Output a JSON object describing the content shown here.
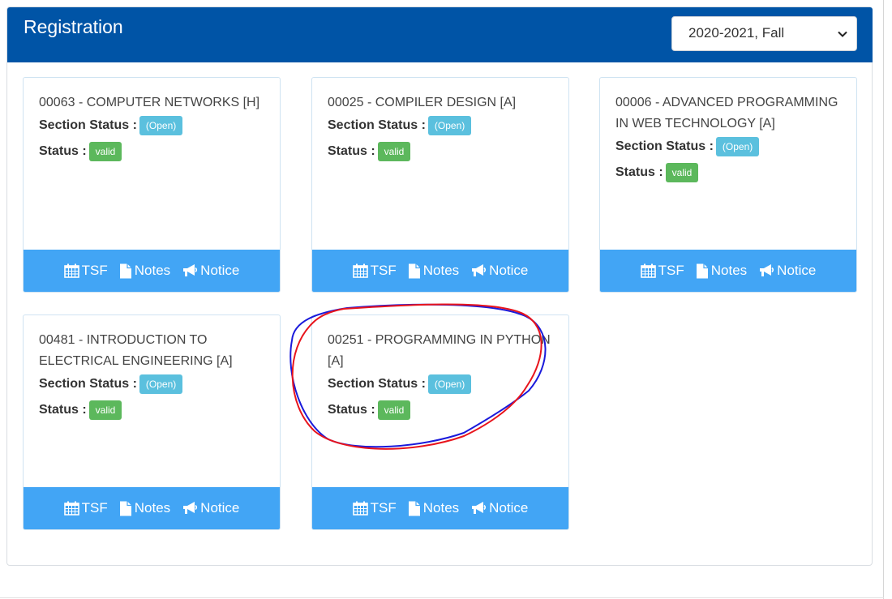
{
  "panel": {
    "title": "Registration",
    "term_select": {
      "value": "2020-2021, Fall"
    }
  },
  "labels": {
    "section_status": "Section Status :",
    "status": "Status :",
    "tsf": "TSF",
    "notes": "Notes",
    "notice": "Notice"
  },
  "courses": [
    {
      "title": "00063 - COMPUTER NETWORKS [H]",
      "section_status": "(Open)",
      "status": "valid"
    },
    {
      "title": "00025 - COMPILER DESIGN [A]",
      "section_status": "(Open)",
      "status": "valid"
    },
    {
      "title": "00006 - ADVANCED PROGRAMMING IN WEB TECHNOLOGY [A]",
      "section_status": "(Open)",
      "status": "valid"
    },
    {
      "title": "00481 - INTRODUCTION TO ELECTRICAL ENGINEERING [A]",
      "section_status": "(Open)",
      "status": "valid"
    },
    {
      "title": "00251 - PROGRAMMING IN PYTHON [A]",
      "section_status": "(Open)",
      "status": "valid"
    }
  ],
  "colors": {
    "header": "#0054a6",
    "footer": "#42a5f5",
    "badge_open": "#5bc0de",
    "badge_valid": "#5cb85c",
    "annotation_red": "#e8141c",
    "annotation_blue": "#1a1adb"
  },
  "icons": [
    "chevron-down-icon",
    "calendar-icon",
    "file-icon",
    "bullhorn-icon"
  ]
}
